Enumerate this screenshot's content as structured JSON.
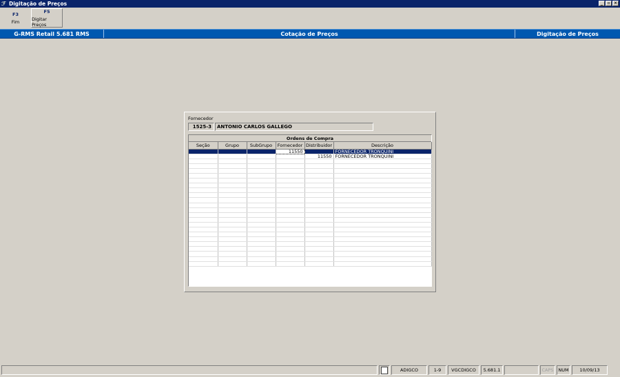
{
  "window": {
    "title": "Digitação de Preços",
    "controls": [
      "_",
      "▫",
      "×"
    ]
  },
  "toolbar": [
    {
      "key": "F3",
      "label": "Fim"
    },
    {
      "key": "F5",
      "label": "Digitar Preços"
    }
  ],
  "header": {
    "app": "G-RMS Retail 5.681 RMS",
    "center": "Cotação de Preços",
    "right": "Digitação de Preços"
  },
  "form": {
    "fornecedor_label": "Fornecedor",
    "fornecedor_code": "1525-3",
    "fornecedor_name": "ANTONIO CARLOS GALLEGO"
  },
  "grid": {
    "title": "Ordens de Compra",
    "columns": [
      "Seção",
      "Grupo",
      "SubGrupo",
      "Fornecedor",
      "Distribuidor",
      "Descrição"
    ],
    "rows": [
      [
        "",
        "",
        "",
        "11550",
        "",
        "FORNECEDOR TRONQUINI"
      ],
      [
        "",
        "",
        "",
        "",
        "11550",
        "FORNECEDOR TRONQUINI"
      ]
    ],
    "selected_row": 0
  },
  "status": {
    "user": "ADIGCO",
    "range": "1-9",
    "program": "VGCDIGCO",
    "version": "5.681.1",
    "caps": "CAPS",
    "num": "NUM",
    "date": "10/09/13"
  }
}
